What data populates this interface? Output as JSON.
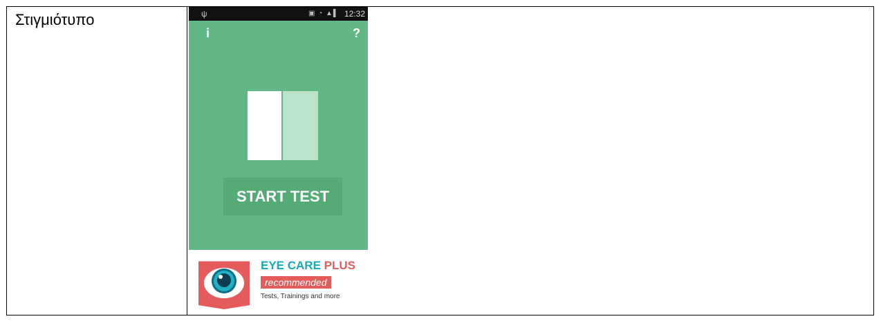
{
  "table": {
    "label": "Στιγμιότυπο"
  },
  "phone": {
    "status_bar": {
      "time": "12:32",
      "icons": [
        "usb-icon",
        "sim-icon",
        "wifi-icon",
        "signal-icon",
        "battery-icon"
      ]
    },
    "info_label": "i",
    "help_label": "?",
    "start_button_label": "START TEST",
    "colors": {
      "background": "#61b885",
      "button": "#54ab76",
      "panel_left": "#ffffff",
      "panel_right": "#bde2cb"
    },
    "ad": {
      "title_main": "EYE CARE ",
      "title_accent": "PLUS",
      "badge": "recommended",
      "subtitle": "Tests, Trainings and more",
      "colors": {
        "title": "#13a8bd",
        "accent": "#e35c5b"
      }
    }
  }
}
